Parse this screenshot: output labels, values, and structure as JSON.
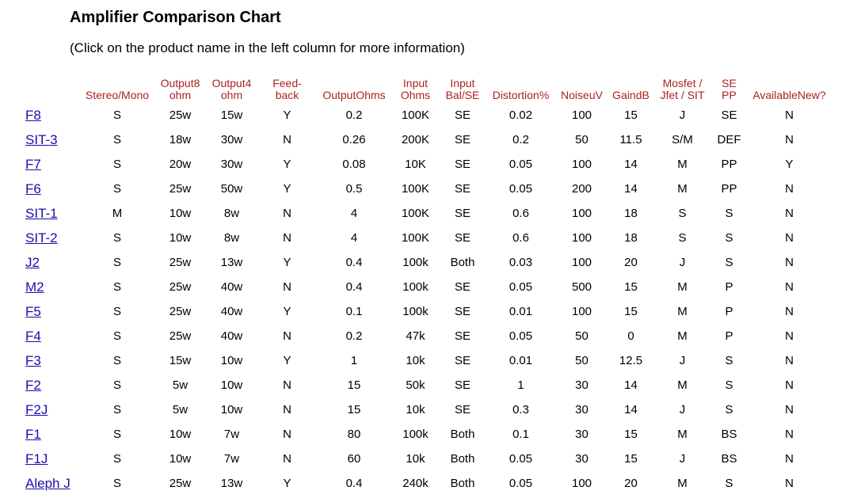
{
  "title": "Amplifier Comparison Chart",
  "subtitle": "(Click on the product name in the left column for more information)",
  "headers": [
    {
      "line1": "",
      "line2": ""
    },
    {
      "line1": "Stereo/Mono",
      "line2": ""
    },
    {
      "line1": "Output8",
      "line2": "ohm"
    },
    {
      "line1": "Output4",
      "line2": "ohm"
    },
    {
      "line1": "Feed-",
      "line2": "back"
    },
    {
      "line1": "OutputOhms",
      "line2": ""
    },
    {
      "line1": "Input",
      "line2": "Ohms"
    },
    {
      "line1": "Input",
      "line2": "Bal/SE"
    },
    {
      "line1": "Distortion%",
      "line2": ""
    },
    {
      "line1": "NoiseuV",
      "line2": ""
    },
    {
      "line1": "GaindB",
      "line2": ""
    },
    {
      "line1": "Mosfet /",
      "line2": "Jfet / SIT"
    },
    {
      "line1": "SE",
      "line2": "PP"
    },
    {
      "line1": "AvailableNew?",
      "line2": ""
    }
  ],
  "rows": [
    [
      "F8",
      "S",
      "25w",
      "15w",
      "Y",
      "0.2",
      "100K",
      "SE",
      "0.02",
      "100",
      "15",
      "J",
      "SE",
      "N"
    ],
    [
      "SIT-3",
      "S",
      "18w",
      "30w",
      "N",
      "0.26",
      "200K",
      "SE",
      "0.2",
      "50",
      "11.5",
      "S/M",
      "DEF",
      "N"
    ],
    [
      "F7",
      "S",
      "20w",
      "30w",
      "Y",
      "0.08",
      "10K",
      "SE",
      "0.05",
      "100",
      "14",
      "M",
      "PP",
      "Y"
    ],
    [
      "F6",
      "S",
      "25w",
      "50w",
      "Y",
      "0.5",
      "100K",
      "SE",
      "0.05",
      "200",
      "14",
      "M",
      "PP",
      "N"
    ],
    [
      "SIT-1",
      "M",
      "10w",
      "8w",
      "N",
      "4",
      "100K",
      "SE",
      "0.6",
      "100",
      "18",
      "S",
      "S",
      "N"
    ],
    [
      "SIT-2",
      "S",
      "10w",
      "8w",
      "N",
      "4",
      "100K",
      "SE",
      "0.6",
      "100",
      "18",
      "S",
      "S",
      "N"
    ],
    [
      "J2",
      "S",
      "25w",
      "13w",
      "Y",
      "0.4",
      "100k",
      "Both",
      "0.03",
      "100",
      "20",
      "J",
      "S",
      "N"
    ],
    [
      "M2",
      "S",
      "25w",
      "40w",
      "N",
      "0.4",
      "100k",
      "SE",
      "0.05",
      "500",
      "15",
      "M",
      "P",
      "N"
    ],
    [
      "F5",
      "S",
      "25w",
      "40w",
      "Y",
      "0.1",
      "100k",
      "SE",
      "0.01",
      "100",
      "15",
      "M",
      "P",
      "N"
    ],
    [
      "F4",
      "S",
      "25w",
      "40w",
      "N",
      "0.2",
      "47k",
      "SE",
      "0.05",
      "50",
      "0",
      "M",
      "P",
      "N"
    ],
    [
      "F3",
      "S",
      "15w",
      "10w",
      "Y",
      "1",
      "10k",
      "SE",
      "0.01",
      "50",
      "12.5",
      "J",
      "S",
      "N"
    ],
    [
      "F2",
      "S",
      "5w",
      "10w",
      "N",
      "15",
      "50k",
      "SE",
      "1",
      "30",
      "14",
      "M",
      "S",
      "N"
    ],
    [
      "F2J",
      "S",
      "5w",
      "10w",
      "N",
      "15",
      "10k",
      "SE",
      "0.3",
      "30",
      "14",
      "J",
      "S",
      "N"
    ],
    [
      "F1",
      "S",
      "10w",
      "7w",
      "N",
      "80",
      "100k",
      "Both",
      "0.1",
      "30",
      "15",
      "M",
      "BS",
      "N"
    ],
    [
      "F1J",
      "S",
      "10w",
      "7w",
      "N",
      "60",
      "10k",
      "Both",
      "0.05",
      "30",
      "15",
      "J",
      "BS",
      "N"
    ],
    [
      "Aleph J",
      "S",
      "25w",
      "13w",
      "Y",
      "0.4",
      "240k",
      "Both",
      "0.05",
      "100",
      "20",
      "M",
      "S",
      "N"
    ]
  ],
  "colors": {
    "header_text": "#aa2222",
    "link": "#1a0dab"
  }
}
